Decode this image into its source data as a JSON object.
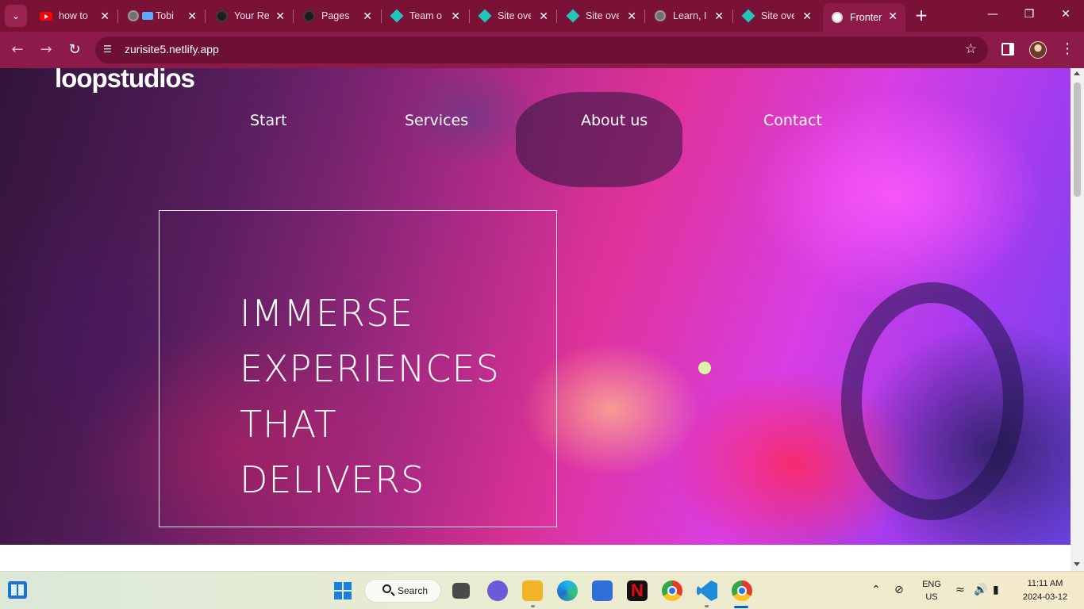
{
  "browser": {
    "tabs": [
      {
        "title": "how to",
        "icon": "youtube-icon"
      },
      {
        "title": "Tobi",
        "icon": "globe-icon"
      },
      {
        "title": "Your Re",
        "icon": "github-icon"
      },
      {
        "title": "Pages",
        "icon": "github-icon"
      },
      {
        "title": "Team o",
        "icon": "netlify-icon"
      },
      {
        "title": "Site ove",
        "icon": "netlify-icon"
      },
      {
        "title": "Site ove",
        "icon": "netlify-icon"
      },
      {
        "title": "Learn, I",
        "icon": "globe-icon"
      },
      {
        "title": "Site ove",
        "icon": "netlify-icon"
      },
      {
        "title": "Fronter",
        "icon": "moon-icon"
      }
    ],
    "active_tab_index": 9,
    "url": "zurisite5.netlify.app",
    "accent_color": "#8c1b4a",
    "tabstrip_color": "#7a1238"
  },
  "page": {
    "logo": "loopstudios",
    "nav": [
      "Start",
      "Services",
      "About us",
      "Contact"
    ],
    "hero_lines": [
      "IMMERSE",
      "EXPERIENCES",
      "THAT",
      "DELIVERS"
    ]
  },
  "taskbar": {
    "search_label": "Search",
    "language": "ENG",
    "region": "US",
    "time": "11:11 AM",
    "date": "2024-03-12",
    "apps": [
      "file-explorer-icon",
      "teams-icon",
      "folder-icon",
      "edge-icon",
      "store-icon",
      "netflix-icon",
      "chrome-icon",
      "vscode-icon",
      "chrome-icon"
    ]
  }
}
